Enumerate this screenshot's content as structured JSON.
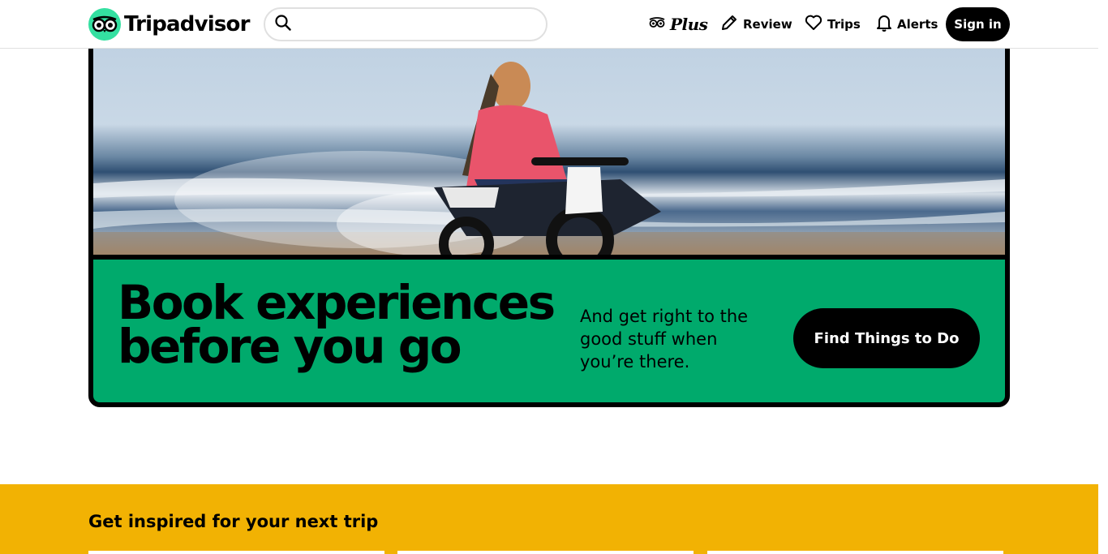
{
  "header": {
    "logo_text": "Tripadvisor",
    "search": {
      "placeholder": "",
      "value": ""
    },
    "nav": {
      "plus_label": "Plus",
      "review_label": "Review",
      "trips_label": "Trips",
      "alerts_label": "Alerts"
    },
    "signin_label": "Sign in"
  },
  "promo": {
    "title_line1": "Book experiences",
    "title_line2": "before you go",
    "subtitle": "And get right to the good stuff when you’re there.",
    "button_label": "Find Things to Do",
    "accent_color": "#00aa6c"
  },
  "inspired": {
    "title": "Get inspired for your next trip",
    "background_color": "#f2b203"
  },
  "icons": [
    "tripadvisor-owl-logo",
    "search-icon",
    "plus-owl-icon",
    "pencil-icon",
    "heart-icon",
    "bell-icon"
  ]
}
